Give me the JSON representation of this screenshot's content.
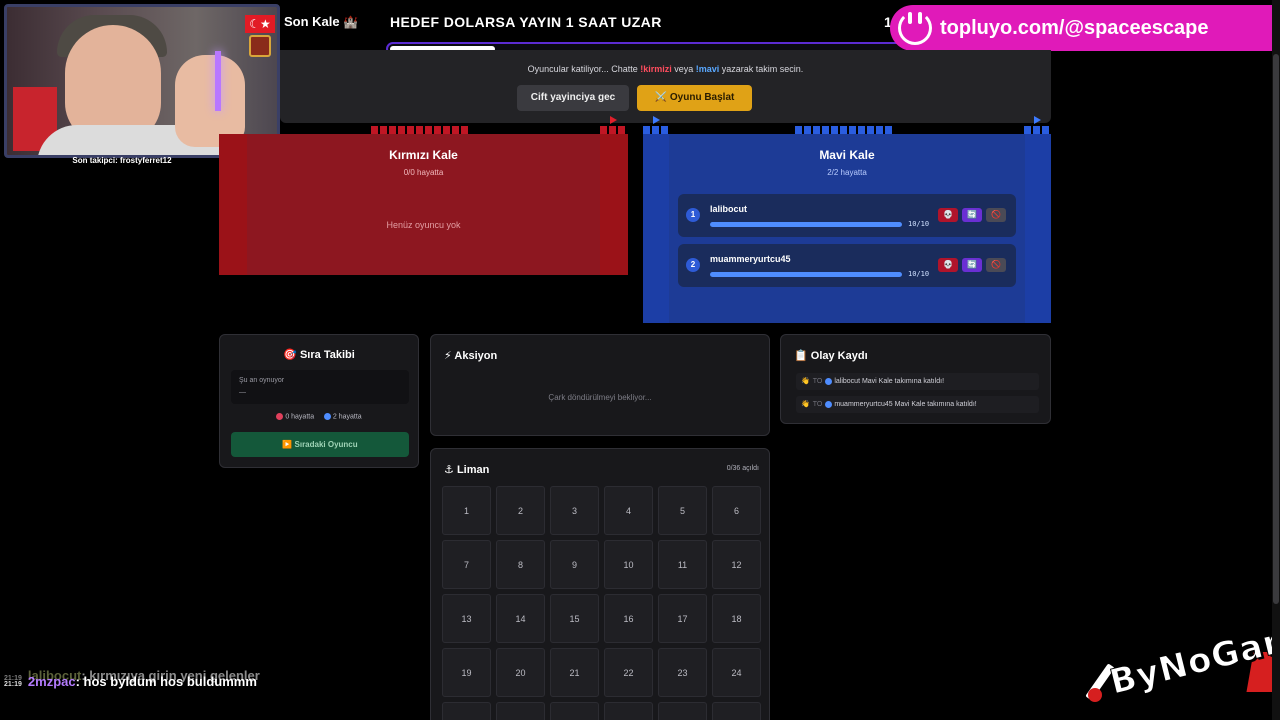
{
  "webcam": {
    "flag_symbol": "☾★",
    "caption": "Son takipci: frostyferret12"
  },
  "header": {
    "son_kale_label": "Son Kale",
    "son_kale_icon": "🏰",
    "goal_title": "HEDEF DOLARSA YAYIN 1 SAAT UZAR",
    "goal_right_value": "1",
    "goal_progress_percent": 20
  },
  "promo": {
    "url": "topluyo.com/@spaceescape"
  },
  "status": {
    "text_before": "Oyuncular katiliyor... Chatte ",
    "red_cmd": "!kirmizi",
    "text_mid": " veya ",
    "blue_cmd": "!mavi",
    "text_after": " yazarak takim secin.",
    "pair_button": "Cift yayinciya gec",
    "start_button": "⚔️ Oyunu Başlat"
  },
  "red_team": {
    "name": "Kırmızı Kale",
    "alive": "0/0 hayatta",
    "empty": "Henüz oyuncu yok",
    "color": "#9b1218"
  },
  "blue_team": {
    "name": "Mavi Kale",
    "alive": "2/2 hayatta",
    "color": "#1c3ea6",
    "players": [
      {
        "rank": "1",
        "name": "lalibocut",
        "hp_text": "10/10",
        "hp_fraction": 1.0
      },
      {
        "rank": "2",
        "name": "muammeryurtcu45",
        "hp_text": "10/10",
        "hp_fraction": 1.0
      }
    ],
    "actions": {
      "skull": "💀",
      "swap": "🔄",
      "ban": "🚫"
    }
  },
  "turn_panel": {
    "icon": "🎯",
    "title": "Sıra Takibi",
    "now_label": "Şu an oynuyor",
    "now_value": "—",
    "red_stat": "0 hayatta",
    "blue_stat": "2 hayatta",
    "next_button": "▶️ Sıradaki Oyuncu"
  },
  "action_panel": {
    "icon": "⚡",
    "title": "Aksiyon",
    "waiting": "Çark döndürülmeyi bekliyor..."
  },
  "log_panel": {
    "icon": "📋",
    "title": "Olay Kaydı",
    "entries": [
      {
        "emoji": "👋",
        "time": "TO",
        "text": "lalibocut Mavi Kale takımına katıldı!"
      },
      {
        "emoji": "👋",
        "time": "TO",
        "text": "muammeryurtcu45 Mavi Kale takımına katıldı!"
      }
    ]
  },
  "port_panel": {
    "icon": "⚓",
    "title": "Liman",
    "count": "0/36 açıldı",
    "cells": [
      "1",
      "2",
      "3",
      "4",
      "5",
      "6",
      "7",
      "8",
      "9",
      "10",
      "11",
      "12",
      "13",
      "14",
      "15",
      "16",
      "17",
      "18",
      "19",
      "20",
      "21",
      "22",
      "23",
      "24",
      "",
      "",
      "",
      "",
      "",
      ""
    ]
  },
  "chat": {
    "line1": {
      "time": "21:19",
      "user": "lalibocut",
      "msg": ": kırmızıya girin yeni gelenler"
    },
    "line2": {
      "time": "21:19",
      "user": "2mzpac",
      "msg": ": hos byldum hos buldummm"
    }
  },
  "logo": {
    "text": "ByNoGam"
  }
}
